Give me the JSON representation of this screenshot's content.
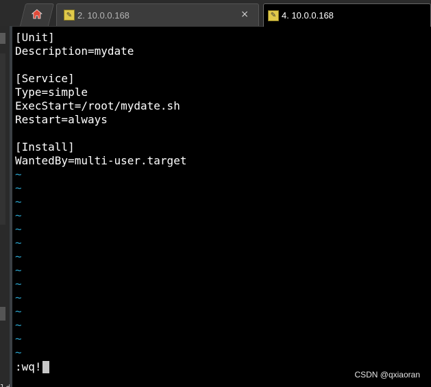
{
  "tabs": [
    {
      "label": "2. 10.0.0.168",
      "active": false,
      "icon": "wrench-icon"
    },
    {
      "label": "4. 10.0.0.168",
      "active": true,
      "icon": "wrench-icon"
    }
  ],
  "home_tab": {
    "icon": "home-icon"
  },
  "close_glyph": "×",
  "left_strip_text": "ld",
  "terminal_lines": [
    "[Unit]",
    "Description=mydate",
    "",
    "[Service]",
    "Type=simple",
    "ExecStart=/root/mydate.sh",
    "Restart=always",
    "",
    "[Install]",
    "WantedBy=multi-user.target"
  ],
  "tilde_char": "~",
  "tilde_count": 14,
  "command": ":wq!",
  "watermark": "CSDN @qxiaoran",
  "colors": {
    "background": "#000000",
    "text": "#ffffff",
    "tilde": "#2aa0c8",
    "tab_bar": "#2b2b2b"
  }
}
